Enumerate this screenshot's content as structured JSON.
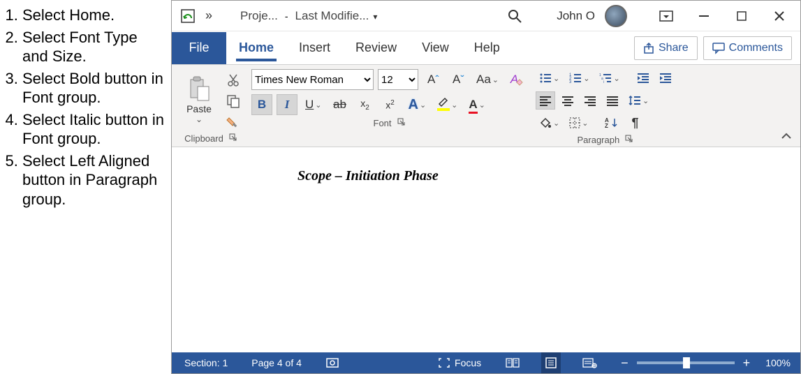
{
  "instructions": {
    "i1": "Select Home.",
    "i2": "Select Font Type and Size.",
    "i3": "Select Bold button in Font group.",
    "i4": "Select Italic button in Font group.",
    "i5": "Select Left Aligned button in Paragraph group."
  },
  "titlebar": {
    "overflow": "»",
    "doc_name": "Proje...",
    "separator": "-",
    "modified": "Last Modifie...",
    "user": "John O"
  },
  "tabs": {
    "file": "File",
    "home": "Home",
    "insert": "Insert",
    "review": "Review",
    "view": "View",
    "help": "Help",
    "share": "Share",
    "comments": "Comments"
  },
  "ribbon": {
    "clipboard": {
      "paste": "Paste",
      "label": "Clipboard"
    },
    "font": {
      "name_value": "Times New Roman",
      "size_value": "12",
      "bold": "B",
      "italic": "I",
      "underline": "U",
      "strike": "ab",
      "sub_base": "x",
      "sup_base": "x",
      "texteff": "A",
      "fontcolor": "A",
      "grow": "A",
      "shrink": "A",
      "changecase": "Aa",
      "clearfmt": "A",
      "label": "Font"
    },
    "paragraph": {
      "sort": "A",
      "pilcrow": "¶",
      "label": "Paragraph"
    }
  },
  "document": {
    "heading": "Scope – Initiation Phase"
  },
  "statusbar": {
    "section": "Section: 1",
    "page": "Page 4 of 4",
    "focus": "Focus",
    "zoom_minus": "−",
    "zoom_plus": "+",
    "zoom_pct": "100%"
  }
}
